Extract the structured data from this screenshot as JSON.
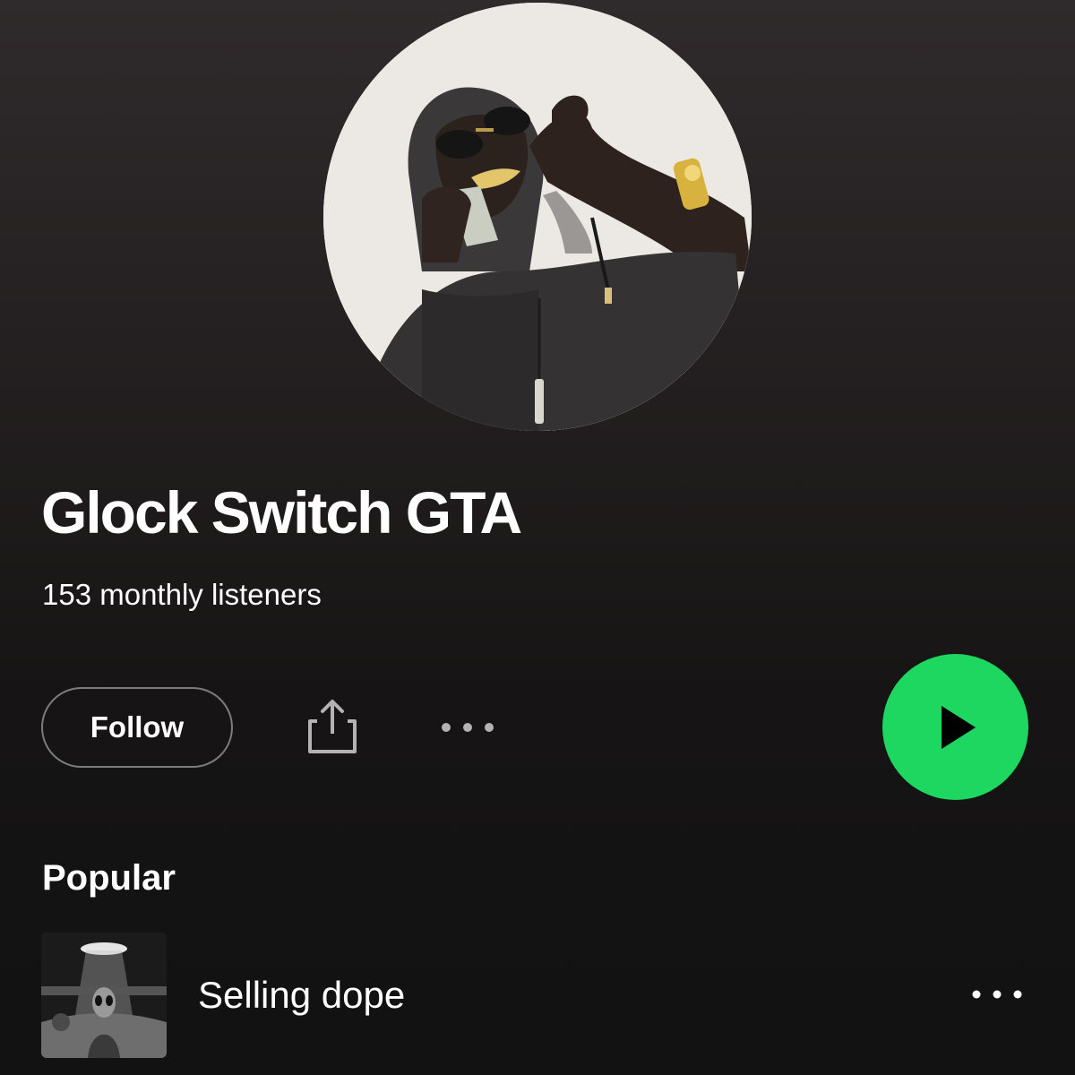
{
  "artist": {
    "name": "Glock Switch GTA",
    "monthly_listeners": "153 monthly listeners",
    "avatar_icon": "artist-photo"
  },
  "actions": {
    "follow_label": "Follow",
    "share_icon": "share-icon",
    "more_icon": "more-options-icon",
    "play_icon": "play-icon"
  },
  "popular": {
    "title": "Popular",
    "tracks": [
      {
        "title": "Selling dope",
        "art_icon": "track-cover-art",
        "more_icon": "more-options-icon"
      }
    ]
  },
  "colors": {
    "accent": "#1ed760",
    "background": "#121212",
    "text": "#ffffff",
    "border": "#7c7c7c"
  }
}
